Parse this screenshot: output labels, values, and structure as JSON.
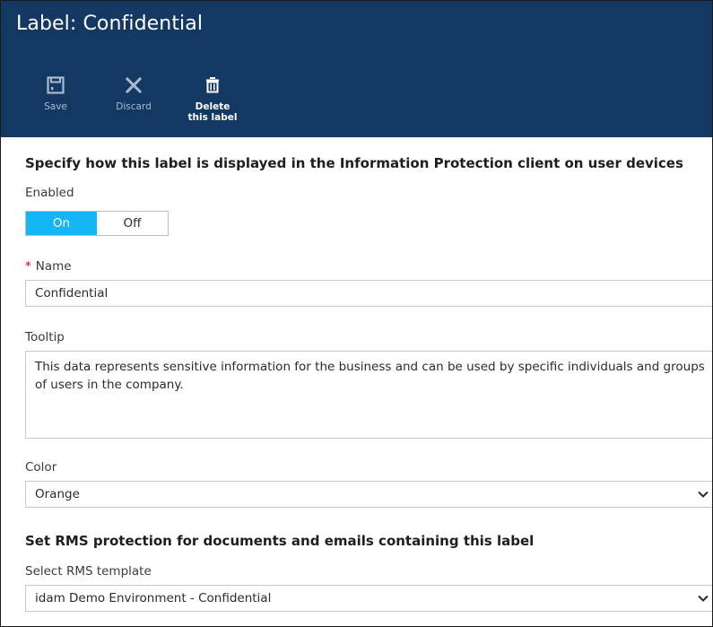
{
  "header": {
    "title": "Label: Confidential",
    "commands": {
      "save": "Save",
      "discard": "Discard",
      "delete": "Delete this label"
    }
  },
  "display_section": {
    "heading": "Specify how this label is displayed in the Information Protection client on user devices",
    "enabled_label": "Enabled",
    "toggle_on": "On",
    "toggle_off": "Off",
    "name_required": "*",
    "name_label": "Name",
    "name_value": "Confidential",
    "tooltip_label": "Tooltip",
    "tooltip_value": "This data represents sensitive information for the business and can be used by specific individuals and groups of users in the company.",
    "color_label": "Color",
    "color_value": "Orange"
  },
  "rms_section": {
    "heading": "Set RMS protection for documents and emails containing this label",
    "template_label": "Select RMS template",
    "template_value": "idam Demo Environment - Confidential"
  },
  "colors": {
    "header_bg": "#133861",
    "toggle_on_bg": "#15b6f5",
    "required_marker": "#d0021b"
  },
  "icons": [
    "save-icon",
    "discard-icon",
    "delete-icon",
    "chevron-down-icon"
  ]
}
